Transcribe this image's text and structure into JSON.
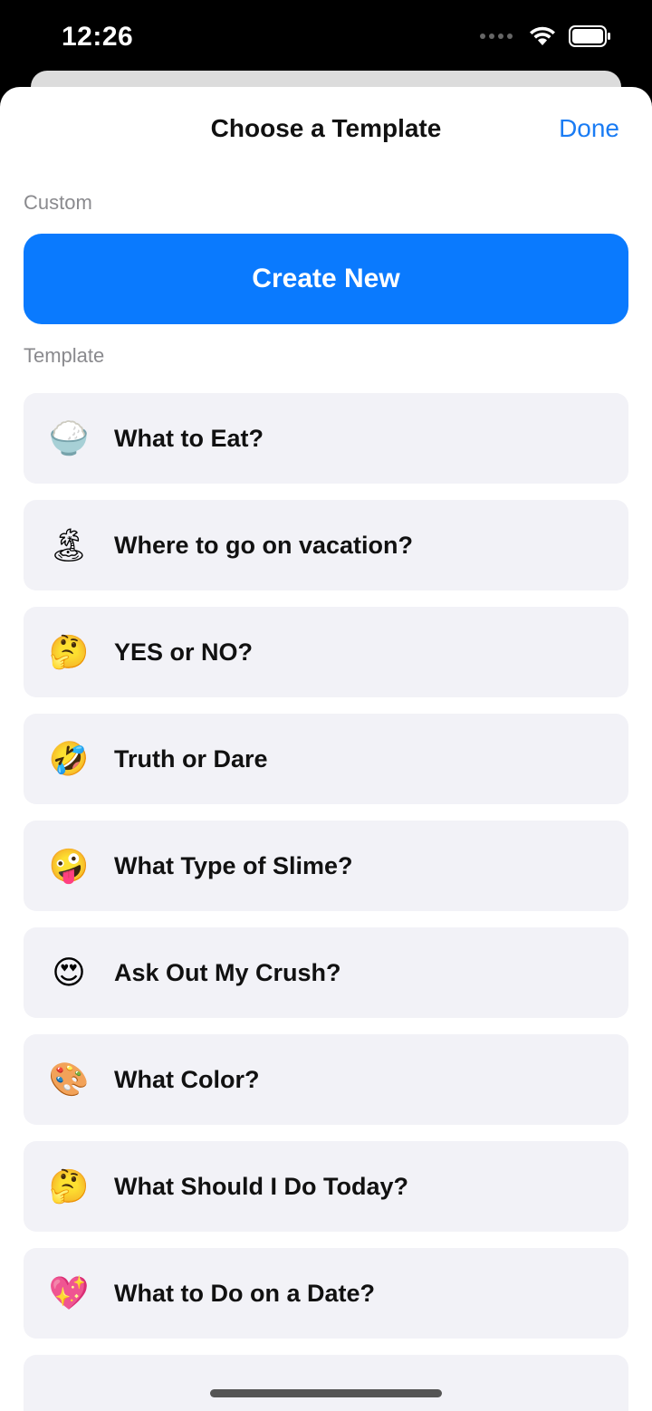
{
  "status_bar": {
    "time": "12:26"
  },
  "sheet": {
    "title": "Choose a Template",
    "done_label": "Done"
  },
  "custom_section": {
    "label": "Custom",
    "create_new_label": "Create New",
    "accent_color": "#0a7afe"
  },
  "template_section": {
    "label": "Template",
    "items": [
      {
        "emoji": "🍚",
        "label": "What to Eat?"
      },
      {
        "emoji": "🏝",
        "label": "Where to go on vacation?"
      },
      {
        "emoji": "🤔",
        "label": "YES or NO?"
      },
      {
        "emoji": "🤣",
        "label": "Truth or Dare"
      },
      {
        "emoji": "🤪",
        "label": "What Type of Slime?"
      },
      {
        "emoji": "😍",
        "label": "Ask Out My Crush?"
      },
      {
        "emoji": "🎨",
        "label": "What Color?"
      },
      {
        "emoji": "🤔",
        "label": "What Should I Do Today?"
      },
      {
        "emoji": "💖",
        "label": "What to Do on a Date?"
      },
      {
        "emoji": "",
        "label": ""
      }
    ]
  }
}
